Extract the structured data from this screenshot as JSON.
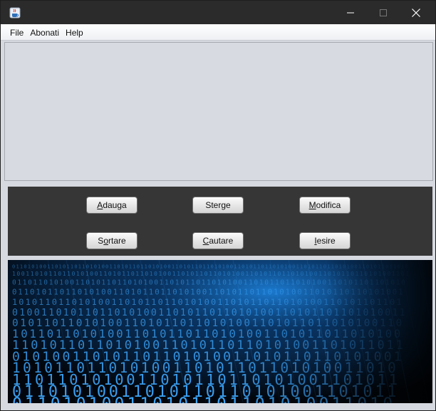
{
  "window": {
    "title": "",
    "icon": "java-cup-icon",
    "controls": [
      "minimize-icon",
      "maximize-icon",
      "close-icon"
    ]
  },
  "menubar": {
    "items": [
      {
        "label": "File"
      },
      {
        "label": "Abonati"
      },
      {
        "label": "Help"
      }
    ]
  },
  "buttons": {
    "adauga": {
      "mnemonic": "A",
      "rest": "dauga"
    },
    "sterge": {
      "pre": "Sterge"
    },
    "modifica": {
      "mnemonic": "M",
      "rest": "odifica"
    },
    "sortare": {
      "pre": "S",
      "mnemonic": "o",
      "rest": "rtare"
    },
    "cautare": {
      "mnemonic": "C",
      "rest": "autare"
    },
    "iesire": {
      "mnemonic": "I",
      "rest": "esire"
    }
  },
  "banner": {
    "description_icon": "binary-code-image",
    "digits": "0110101001101011"
  },
  "colors": {
    "titlebar": "#2b2b2b",
    "panel_bg": "#d7dae0",
    "button_panel": "#363636",
    "binary_glow": "#3fa9ff"
  }
}
